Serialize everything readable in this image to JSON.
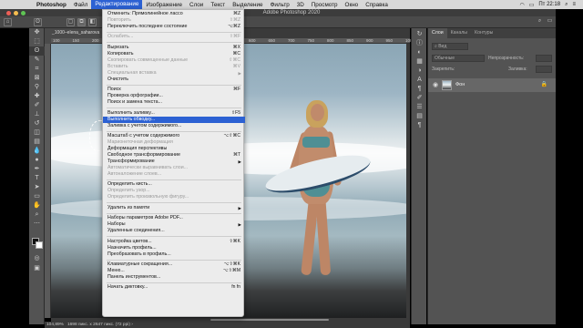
{
  "mac_menubar": {
    "app": "Photoshop",
    "items": [
      "Файл",
      "Редактирование",
      "Изображение",
      "Слои",
      "Текст",
      "Выделение",
      "Фильтр",
      "3D",
      "Просмотр",
      "Окно",
      "Справка"
    ],
    "active_index": 1,
    "clock": "Пт 22:18"
  },
  "window": {
    "title": "Adobe Photoshop 2020"
  },
  "document": {
    "tab_title": "_1000–elena_saharova",
    "zoom": "104,89%",
    "doc_info": "1698 пикс. x 2647 пикс. (72 ppi)",
    "ruler_ticks": [
      "100",
      "150",
      "200",
      "250",
      "300",
      "350",
      "400",
      "450",
      "500",
      "550",
      "600",
      "650",
      "700",
      "750",
      "800",
      "850",
      "900",
      "950",
      "1000"
    ]
  },
  "layers_panel": {
    "tabs": [
      "Слои",
      "Каналы",
      "Контуры"
    ],
    "filter_placeholder": "Вид",
    "blend_mode": "Обычные",
    "opacity_label": "Непрозрачность:",
    "lock_label": "Закрепить:",
    "fill_label": "Заливка:",
    "layer_name": "Фон"
  },
  "edit_menu": {
    "items": [
      {
        "label": "Отменить: Прямолинейное лассо",
        "shortcut": "⌘Z",
        "disabled": false
      },
      {
        "label": "Повторить",
        "shortcut": "⇧⌘Z",
        "disabled": true
      },
      {
        "label": "Переключить последнее состояние",
        "shortcut": "⌥⌘Z",
        "disabled": false
      },
      {
        "sep": true
      },
      {
        "label": "Ослабить...",
        "shortcut": "⇧⌘F",
        "disabled": true
      },
      {
        "sep": true
      },
      {
        "label": "Вырезать",
        "shortcut": "⌘X",
        "disabled": false
      },
      {
        "label": "Копировать",
        "shortcut": "⌘C",
        "disabled": false
      },
      {
        "label": "Скопировать совмещенные данные",
        "shortcut": "⇧⌘C",
        "disabled": true
      },
      {
        "label": "Вставить",
        "shortcut": "⌘V",
        "disabled": true
      },
      {
        "label": "Специальная вставка",
        "shortcut": "",
        "disabled": true,
        "submenu": true
      },
      {
        "label": "Очистить",
        "shortcut": "",
        "disabled": false
      },
      {
        "sep": true
      },
      {
        "label": "Поиск",
        "shortcut": "⌘F",
        "disabled": false
      },
      {
        "label": "Проверка орфографии...",
        "shortcut": "",
        "disabled": false
      },
      {
        "label": "Поиск и замена текста...",
        "shortcut": "",
        "disabled": false
      },
      {
        "sep": true
      },
      {
        "label": "Выполнить заливку...",
        "shortcut": "⇧F5",
        "disabled": false
      },
      {
        "label": "Выполнить обводку...",
        "shortcut": "",
        "disabled": false,
        "highlight": true
      },
      {
        "label": "Заливка с учетом содержимого...",
        "shortcut": "",
        "disabled": false
      },
      {
        "sep": true
      },
      {
        "label": "Масштаб с учетом содержимого",
        "shortcut": "⌥⇧⌘C",
        "disabled": false
      },
      {
        "label": "Марионеточная деформация",
        "shortcut": "",
        "disabled": true
      },
      {
        "label": "Деформация перспективы",
        "shortcut": "",
        "disabled": false
      },
      {
        "label": "Свободное трансформирование",
        "shortcut": "⌘T",
        "disabled": false
      },
      {
        "label": "Трансформирование",
        "shortcut": "",
        "disabled": false,
        "submenu": true
      },
      {
        "label": "Автоматически выравнивать слои...",
        "shortcut": "",
        "disabled": true
      },
      {
        "label": "Автоналожение слоев...",
        "shortcut": "",
        "disabled": true
      },
      {
        "sep": true
      },
      {
        "label": "Определить кисть...",
        "shortcut": "",
        "disabled": false
      },
      {
        "label": "Определить узор...",
        "shortcut": "",
        "disabled": true
      },
      {
        "label": "Определить произвольную фигуру...",
        "shortcut": "",
        "disabled": true
      },
      {
        "sep": true
      },
      {
        "label": "Удалить из памяти",
        "shortcut": "",
        "disabled": false,
        "submenu": true
      },
      {
        "sep": true
      },
      {
        "label": "Наборы параметров Adobe PDF...",
        "shortcut": "",
        "disabled": false
      },
      {
        "label": "Наборы",
        "shortcut": "",
        "disabled": false,
        "submenu": true
      },
      {
        "label": "Удаленные соединения...",
        "shortcut": "",
        "disabled": false
      },
      {
        "sep": true
      },
      {
        "label": "Настройка цветов...",
        "shortcut": "⇧⌘K",
        "disabled": false
      },
      {
        "label": "Назначить профиль...",
        "shortcut": "",
        "disabled": false
      },
      {
        "label": "Преобразовать в профиль...",
        "shortcut": "",
        "disabled": false
      },
      {
        "sep": true
      },
      {
        "label": "Клавиатурные сокращения...",
        "shortcut": "⌥⇧⌘K",
        "disabled": false
      },
      {
        "label": "Меню...",
        "shortcut": "⌥⇧⌘M",
        "disabled": false
      },
      {
        "label": "Панель инструментов...",
        "shortcut": "",
        "disabled": false
      },
      {
        "sep": true
      },
      {
        "label": "Начать диктовку...",
        "shortcut": "fn fn",
        "disabled": false
      }
    ]
  },
  "colors": {
    "menu_highlight": "#2c61d3",
    "menubar": "#d8d8d8",
    "ps_panel": "#535353"
  }
}
